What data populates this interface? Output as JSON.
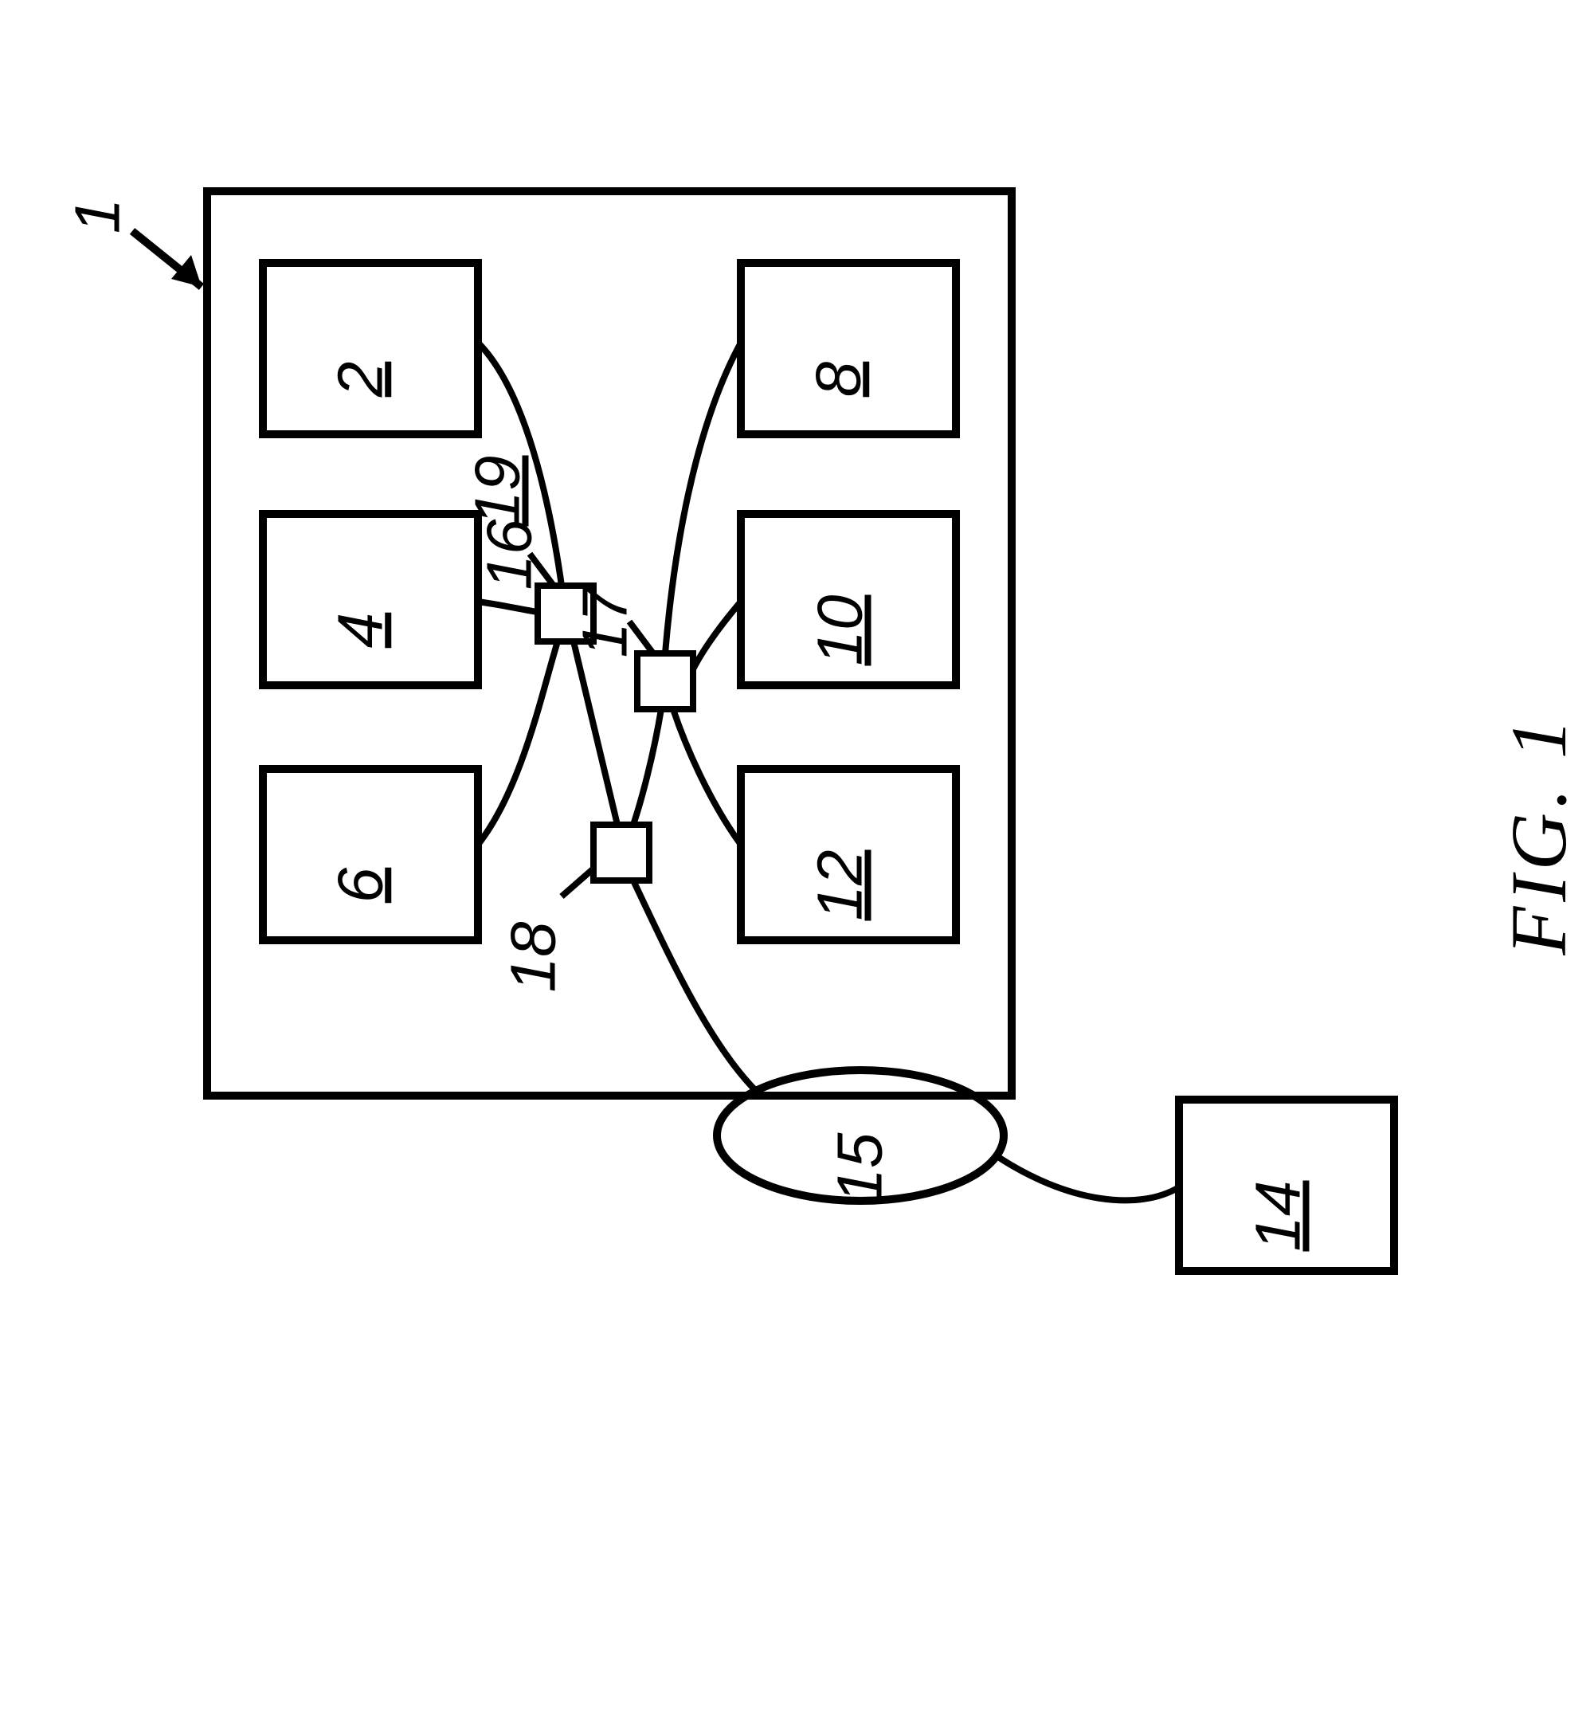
{
  "figure": {
    "caption": "FIG. 1",
    "container_label": "1",
    "area_label": "19",
    "boxes": {
      "b2": "2",
      "b4": "4",
      "b6": "6",
      "b8": "8",
      "b10": "10",
      "b12": "12",
      "b14": "14"
    },
    "small_nodes": {
      "n16": "16",
      "n17": "17",
      "n18": "18"
    },
    "cloud": "15"
  }
}
